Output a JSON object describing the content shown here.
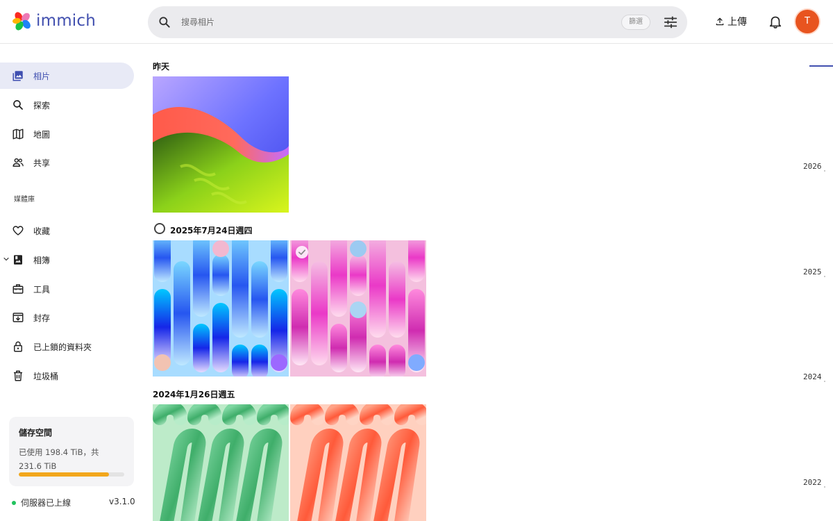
{
  "app": {
    "name": "immich"
  },
  "header": {
    "search_placeholder": "搜尋相片",
    "clear_label": "篩選",
    "upload_label": "上傳",
    "avatar_initial": "T"
  },
  "sidebar": {
    "items": [
      {
        "label": "相片",
        "icon": "photos-icon",
        "active": true
      },
      {
        "label": "探索",
        "icon": "search-icon"
      },
      {
        "label": "地圖",
        "icon": "map-icon"
      },
      {
        "label": "共享",
        "icon": "people-icon"
      }
    ],
    "library_label": "媒體庫",
    "library_items": [
      {
        "label": "收藏",
        "icon": "heart-icon"
      },
      {
        "label": "相簿",
        "icon": "album-icon"
      },
      {
        "label": "工具",
        "icon": "toolbox-icon"
      },
      {
        "label": "封存",
        "icon": "archive-icon"
      },
      {
        "label": "已上鎖的資料夾",
        "icon": "lock-icon"
      },
      {
        "label": "垃圾桶",
        "icon": "trash-icon"
      }
    ],
    "storage": {
      "title": "儲存空間",
      "used_text": "已使用 198.4 TiB，共 231.6 TiB",
      "used_fraction": 0.857
    },
    "server_status": "伺服器已上線",
    "version": "v3.1.0"
  },
  "timeline_groups": [
    {
      "date": "昨天"
    },
    {
      "date": "2025年7月24日週四"
    },
    {
      "date": "2024年1月26日週五"
    }
  ],
  "scrubber": {
    "years": [
      "2026",
      "2025",
      "2024",
      "2022"
    ]
  },
  "colors": {
    "accent": "#4250af",
    "active_bg": "#e8eaf6",
    "storage_fill": "#f2a71b",
    "online": "#22c35e",
    "avatar": "#e8541f"
  }
}
